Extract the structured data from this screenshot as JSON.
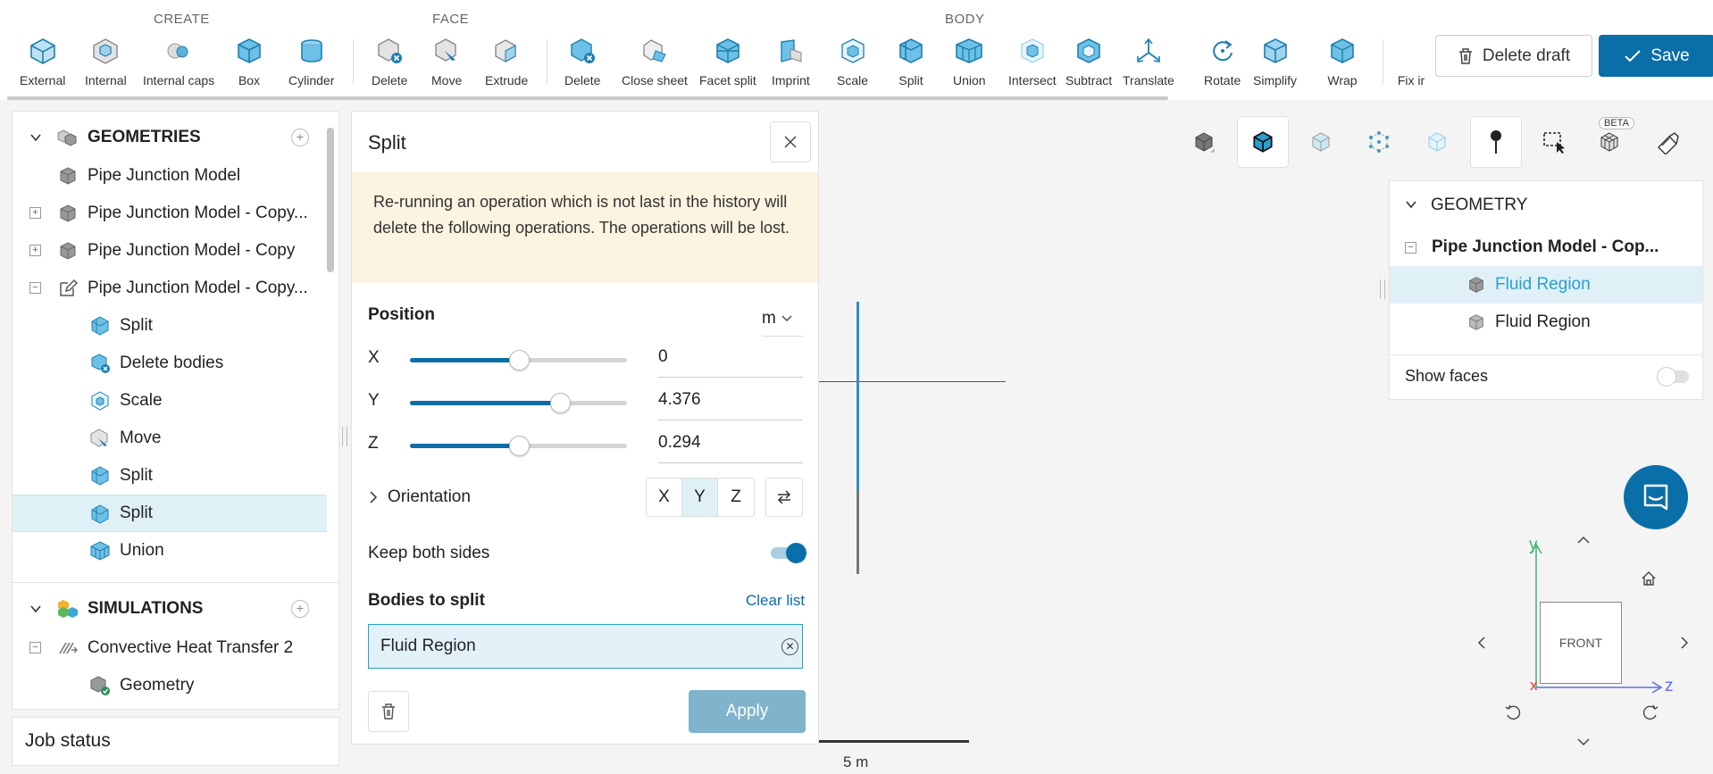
{
  "toolbar": {
    "groups": {
      "create": "CREATE",
      "face": "FACE",
      "body": "BODY"
    },
    "create_buttons": [
      "External",
      "Internal",
      "Internal caps",
      "Box",
      "Cylinder"
    ],
    "face_buttons": [
      "Delete",
      "Move",
      "Extrude"
    ],
    "body_buttons": [
      "Delete",
      "Close sheet",
      "Facet split",
      "Imprint",
      "Scale",
      "Split",
      "Union",
      "Intersect",
      "Subtract",
      "Translate",
      "Rotate",
      "Simplify",
      "Wrap",
      "Fix ir"
    ],
    "delete_draft_label": "Delete draft",
    "save_label": "Save"
  },
  "left_tree": {
    "geometries_header": "GEOMETRIES",
    "geometries": [
      {
        "label": "Pipe Junction Model"
      },
      {
        "label": "Pipe Junction Model - Copy..."
      },
      {
        "label": "Pipe Junction Model - Copy"
      },
      {
        "label": "Pipe Junction Model - Copy..."
      }
    ],
    "operations": [
      "Split",
      "Delete bodies",
      "Scale",
      "Move",
      "Split",
      "Split",
      "Union"
    ],
    "simulations_header": "SIMULATIONS",
    "simulation": "Convective Heat Transfer 2",
    "simulation_child": "Geometry",
    "job_status": "Job status"
  },
  "split_panel": {
    "title": "Split",
    "warning": "Re-running an operation which is not last in the history will delete the following operations. The operations will be lost.",
    "position_label": "Position",
    "unit": "m",
    "axes": [
      {
        "label": "X",
        "value": "0",
        "fraction": 0.5
      },
      {
        "label": "Y",
        "value": "4.376",
        "fraction": 0.69
      },
      {
        "label": "Z",
        "value": "0.294",
        "fraction": 0.5
      }
    ],
    "orientation_label": "Orientation",
    "orientation_options": [
      "X",
      "Y",
      "Z"
    ],
    "orientation_selected": "Y",
    "keep_both_sides_label": "Keep both sides",
    "keep_both_sides": true,
    "bodies_label": "Bodies to split",
    "clear_list_label": "Clear list",
    "bodies": [
      "Fluid Region"
    ],
    "apply_label": "Apply"
  },
  "viewport": {
    "scale_label": "5 m",
    "beta_label": "BETA",
    "navcube_face": "FRONT",
    "axis_y": "y",
    "axis_z": "z",
    "axis_x": "x"
  },
  "geometry_panel": {
    "header": "GEOMETRY",
    "model": "Pipe Junction Model - Cop...",
    "bodies": [
      "Fluid Region",
      "Fluid Region"
    ],
    "selected_index": 0,
    "show_faces_label": "Show faces",
    "show_faces": false
  },
  "colors": {
    "accent": "#0a6ea8",
    "selection": "#dff0f7",
    "warning_bg": "#fcf3e0",
    "link": "#2a9fd0"
  }
}
